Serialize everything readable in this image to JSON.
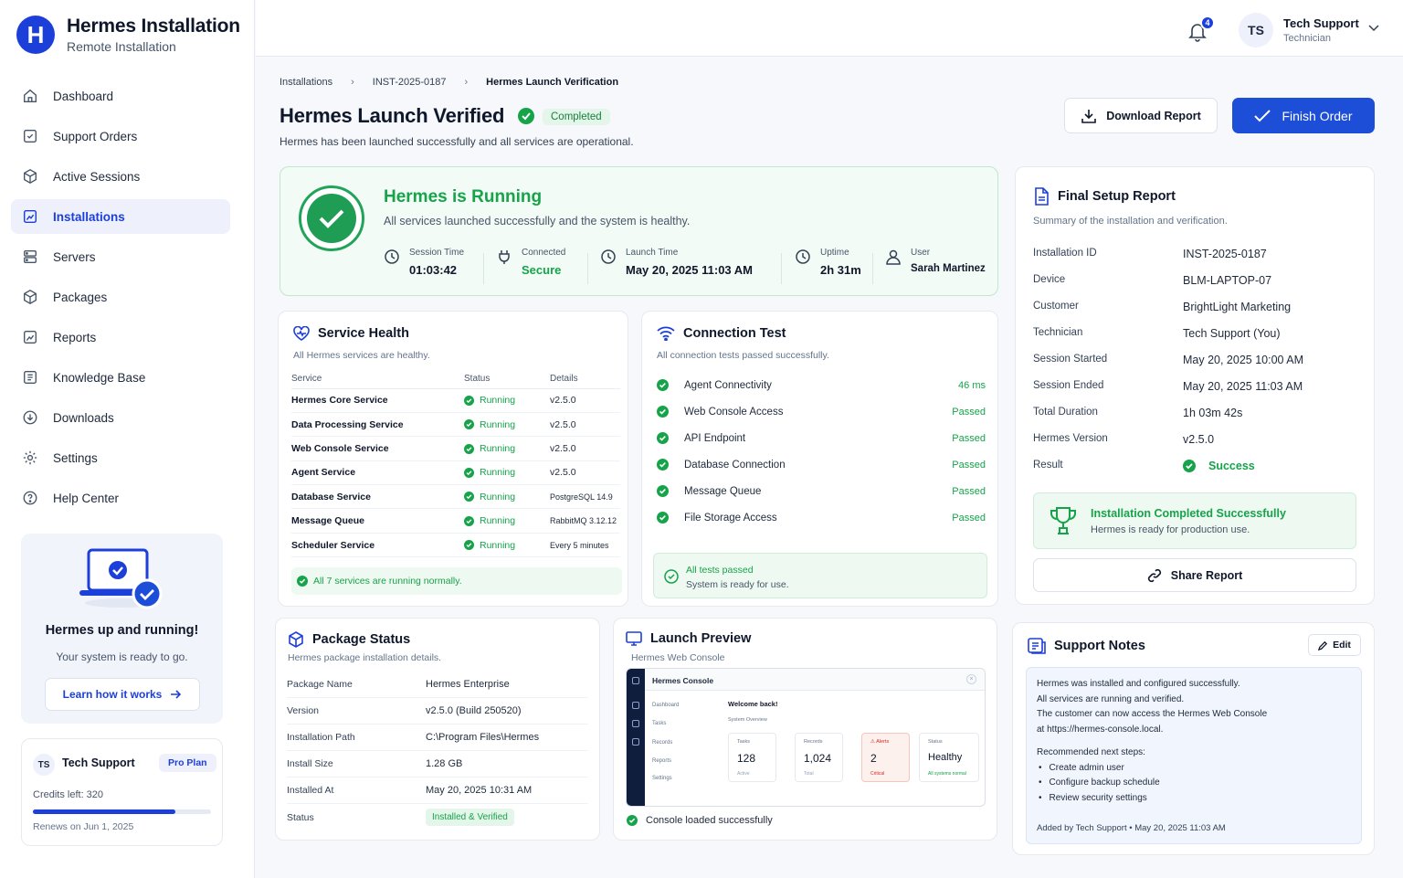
{
  "brand": {
    "logo_letter": "H",
    "title": "Hermes Installation",
    "subtitle": "Remote Installation"
  },
  "nav": [
    {
      "label": "Dashboard",
      "icon": "home-icon"
    },
    {
      "label": "Support Orders",
      "icon": "checklist-icon"
    },
    {
      "label": "Active Sessions",
      "icon": "sessions-icon"
    },
    {
      "label": "Installations",
      "icon": "installations-icon",
      "active": true
    },
    {
      "label": "Servers",
      "icon": "server-icon"
    },
    {
      "label": "Packages",
      "icon": "package-icon"
    },
    {
      "label": "Reports",
      "icon": "reports-icon"
    },
    {
      "label": "Knowledge Base",
      "icon": "book-icon"
    },
    {
      "label": "Downloads",
      "icon": "download-icon"
    },
    {
      "label": "Settings",
      "icon": "gear-icon"
    },
    {
      "label": "Help Center",
      "icon": "help-icon"
    }
  ],
  "promo": {
    "title": "Hermes up and running!",
    "subtitle": "Your system is ready to go.",
    "button": "Learn how it works"
  },
  "plan": {
    "initials": "TS",
    "name": "Tech Support",
    "badge": "Pro Plan",
    "credits": "Credits left: 320",
    "credit_fraction": 0.8,
    "renews": "Renews on Jun 1, 2025"
  },
  "topbar": {
    "notifications": "4",
    "user_initials": "TS",
    "user_name": "Tech Support",
    "user_role": "Technician"
  },
  "breadcrumb": [
    "Installations",
    "INST-2025-0187",
    "Hermes Launch Verification"
  ],
  "page": {
    "title": "Hermes Launch Verified",
    "status": "Completed",
    "subtitle": "Hermes has been launched successfully and all services are operational.",
    "download_button": "Download Report",
    "finish_button": "Finish Order"
  },
  "hero": {
    "title": "Hermes is Running",
    "subtitle": "All services launched successfully and the system is healthy.",
    "stats": [
      {
        "label": "Session Time",
        "value": "01:03:42"
      },
      {
        "label": "Connected",
        "value": "Secure"
      },
      {
        "label": "Launch Time",
        "value": "May 20, 2025  11:03 AM"
      },
      {
        "label": "Uptime",
        "value": "2h 31m"
      },
      {
        "label": "User",
        "value": "Sarah Martinez"
      }
    ]
  },
  "service_health": {
    "title": "Service Health",
    "subtitle": "All Hermes services are healthy.",
    "columns": [
      "Service",
      "Status",
      "Details"
    ],
    "rows": [
      {
        "service": "Hermes Core Service",
        "status": "Running",
        "details": "v2.5.0"
      },
      {
        "service": "Data Processing Service",
        "status": "Running",
        "details": "v2.5.0"
      },
      {
        "service": "Web Console Service",
        "status": "Running",
        "details": "v2.5.0"
      },
      {
        "service": "Agent Service",
        "status": "Running",
        "details": "v2.5.0"
      },
      {
        "service": "Database Service",
        "status": "Running",
        "details": "PostgreSQL 14.9"
      },
      {
        "service": "Message Queue",
        "status": "Running",
        "details": "RabbitMQ 3.12.12"
      },
      {
        "service": "Scheduler Service",
        "status": "Running",
        "details": "Every 5 minutes"
      }
    ],
    "footer": "All 7 services are running normally."
  },
  "connection_test": {
    "title": "Connection Test",
    "subtitle": "All connection tests passed successfully.",
    "rows": [
      {
        "name": "Agent Connectivity",
        "result": "46 ms"
      },
      {
        "name": "Web Console Access",
        "result": "Passed"
      },
      {
        "name": "API Endpoint",
        "result": "Passed"
      },
      {
        "name": "Database Connection",
        "result": "Passed"
      },
      {
        "name": "Message Queue",
        "result": "Passed"
      },
      {
        "name": "File Storage Access",
        "result": "Passed"
      }
    ],
    "footer_title": "All tests passed",
    "footer_sub": "System is ready for use."
  },
  "final_report": {
    "title": "Final Setup Report",
    "subtitle": "Summary of the installation and verification.",
    "fields": [
      {
        "key": "Installation ID",
        "value": "INST-2025-0187"
      },
      {
        "key": "Device",
        "value": "BLM-LAPTOP-07"
      },
      {
        "key": "Customer",
        "value": "BrightLight Marketing"
      },
      {
        "key": "Technician",
        "value": "Tech Support (You)"
      },
      {
        "key": "Session Started",
        "value": "May 20, 2025  10:00 AM"
      },
      {
        "key": "Session Ended",
        "value": "May 20, 2025  11:03 AM"
      },
      {
        "key": "Total Duration",
        "value": "1h 03m 42s"
      },
      {
        "key": "Hermes Version",
        "value": "v2.5.0"
      },
      {
        "key": "Result",
        "value": "Success"
      }
    ],
    "success_title": "Installation Completed Successfully",
    "success_sub": "Hermes is ready for production use.",
    "share_button": "Share Report"
  },
  "package_status": {
    "title": "Package Status",
    "subtitle": "Hermes package installation details.",
    "fields": [
      {
        "key": "Package Name",
        "value": "Hermes Enterprise"
      },
      {
        "key": "Version",
        "value": "v2.5.0 (Build 250520)"
      },
      {
        "key": "Installation Path",
        "value": "C:\\Program Files\\Hermes"
      },
      {
        "key": "Install Size",
        "value": "1.28 GB"
      },
      {
        "key": "Installed At",
        "value": "May 20, 2025 10:31 AM"
      },
      {
        "key": "Status",
        "value": "Installed & Verified"
      }
    ]
  },
  "launch_preview": {
    "title": "Launch Preview",
    "subtitle": "Hermes Web Console",
    "console": {
      "title": "Hermes Console",
      "nav": [
        "Dashboard",
        "Tasks",
        "Records",
        "Reports",
        "Settings"
      ],
      "welcome": "Welcome back!",
      "overview": "System Overview",
      "tiles": [
        {
          "label": "Tasks",
          "value": "128",
          "sub": "Active"
        },
        {
          "label": "Records",
          "value": "1,024",
          "sub": "Total"
        },
        {
          "label": "Alerts",
          "value": "2",
          "sub": "Critical"
        },
        {
          "label": "Status",
          "value": "Healthy",
          "sub": "All systems normal"
        }
      ]
    },
    "footer": "Console loaded successfully"
  },
  "support_notes": {
    "title": "Support Notes",
    "edit": "Edit",
    "lines": [
      "Hermes was installed and configured successfully.",
      "All services are running and verified.",
      "The customer can now access the Hermes Web Console",
      "at https://hermes-console.local."
    ],
    "steps_title": "Recommended next steps:",
    "steps": [
      "Create admin user",
      "Configure backup schedule",
      "Review security settings"
    ],
    "meta": "Added by Tech Support  •  May 20, 2025  11:03 AM"
  }
}
